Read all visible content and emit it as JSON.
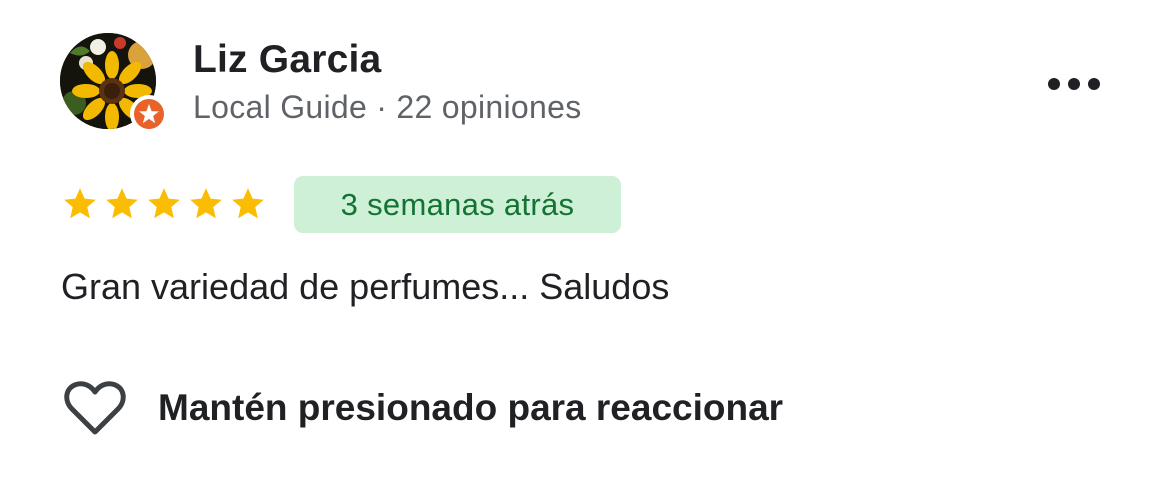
{
  "reviewer": {
    "name": "Liz Garcia",
    "meta": "Local Guide · 22 opiniones"
  },
  "review": {
    "rating": 5,
    "rating_max": 5,
    "date": "3 semanas atrás",
    "text": "Gran variedad de perfumes... Saludos"
  },
  "actions": {
    "react_label": "Mantén presionado para reaccionar"
  },
  "icons": {
    "avatar": "sunflower-avatar",
    "badge": "local-guide-star-badge",
    "more": "more-horizontal-icon",
    "star": "star-icon",
    "heart": "heart-outline-icon"
  },
  "colors": {
    "star": "#fbbc04",
    "badge_bg": "#cdf0d6",
    "badge_text": "#137333",
    "guide_badge": "#e8622a",
    "meta_text": "#5f6368"
  }
}
